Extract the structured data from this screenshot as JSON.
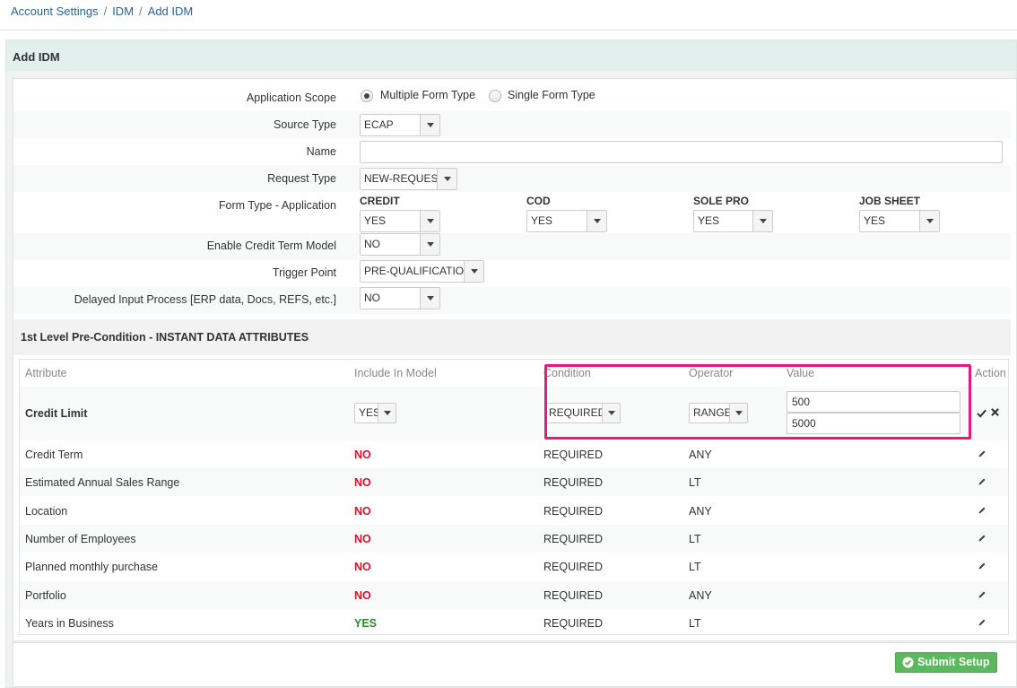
{
  "breadcrumb": [
    "Account Settings",
    "IDM",
    "Add IDM"
  ],
  "panel_title": "Add IDM",
  "form": {
    "application_scope": {
      "label": "Application Scope",
      "options": [
        "Multiple Form Type",
        "Single Form Type"
      ],
      "selected": "Multiple Form Type"
    },
    "source_type": {
      "label": "Source Type",
      "value": "ECAP"
    },
    "name": {
      "label": "Name",
      "value": ""
    },
    "request_type": {
      "label": "Request Type",
      "value": "NEW-REQUEST"
    },
    "form_type": {
      "label": "Form Type - Application",
      "items": [
        {
          "label": "CREDIT",
          "value": "YES"
        },
        {
          "label": "COD",
          "value": "YES"
        },
        {
          "label": "SOLE PRO",
          "value": "YES"
        },
        {
          "label": "JOB SHEET",
          "value": "YES"
        }
      ]
    },
    "credit_term_model": {
      "label": "Enable Credit Term Model",
      "value": "NO"
    },
    "trigger_point": {
      "label": "Trigger Point",
      "value": "PRE-QUALIFICATION"
    },
    "delayed_input": {
      "label": "Delayed Input Process [ERP data, Docs, REFS, etc.]",
      "value": "NO"
    }
  },
  "section_title": "1st Level Pre-Condition - INSTANT DATA ATTRIBUTES",
  "table": {
    "headers": {
      "attribute": "Attribute",
      "include": "Include In Model",
      "condition": "Condition",
      "operator": "Operator",
      "value": "Value",
      "action": "Action"
    },
    "editing_row": {
      "attribute": "Credit Limit",
      "include": "YES",
      "condition": "REQUIRED",
      "operator": "RANGE",
      "value_min": "500",
      "value_max": "5000"
    },
    "rows": [
      {
        "attribute": "Credit Term",
        "include": "NO",
        "condition": "REQUIRED",
        "operator": "ANY"
      },
      {
        "attribute": "Estimated Annual Sales Range",
        "include": "NO",
        "condition": "REQUIRED",
        "operator": "LT"
      },
      {
        "attribute": "Location",
        "include": "NO",
        "condition": "REQUIRED",
        "operator": "ANY"
      },
      {
        "attribute": "Number of Employees",
        "include": "NO",
        "condition": "REQUIRED",
        "operator": "LT"
      },
      {
        "attribute": "Planned monthly purchase",
        "include": "NO",
        "condition": "REQUIRED",
        "operator": "LT"
      },
      {
        "attribute": "Portfolio",
        "include": "NO",
        "condition": "REQUIRED",
        "operator": "ANY"
      },
      {
        "attribute": "Years in Business",
        "include": "YES",
        "condition": "REQUIRED",
        "operator": "LT"
      }
    ]
  },
  "submit_label": "Submit Setup",
  "colors": {
    "accent_green": "#5cb85c",
    "no_red": "#d9142b",
    "yes_green": "#2d8a2d",
    "highlight": "#e8197d",
    "link": "#2a6496"
  }
}
